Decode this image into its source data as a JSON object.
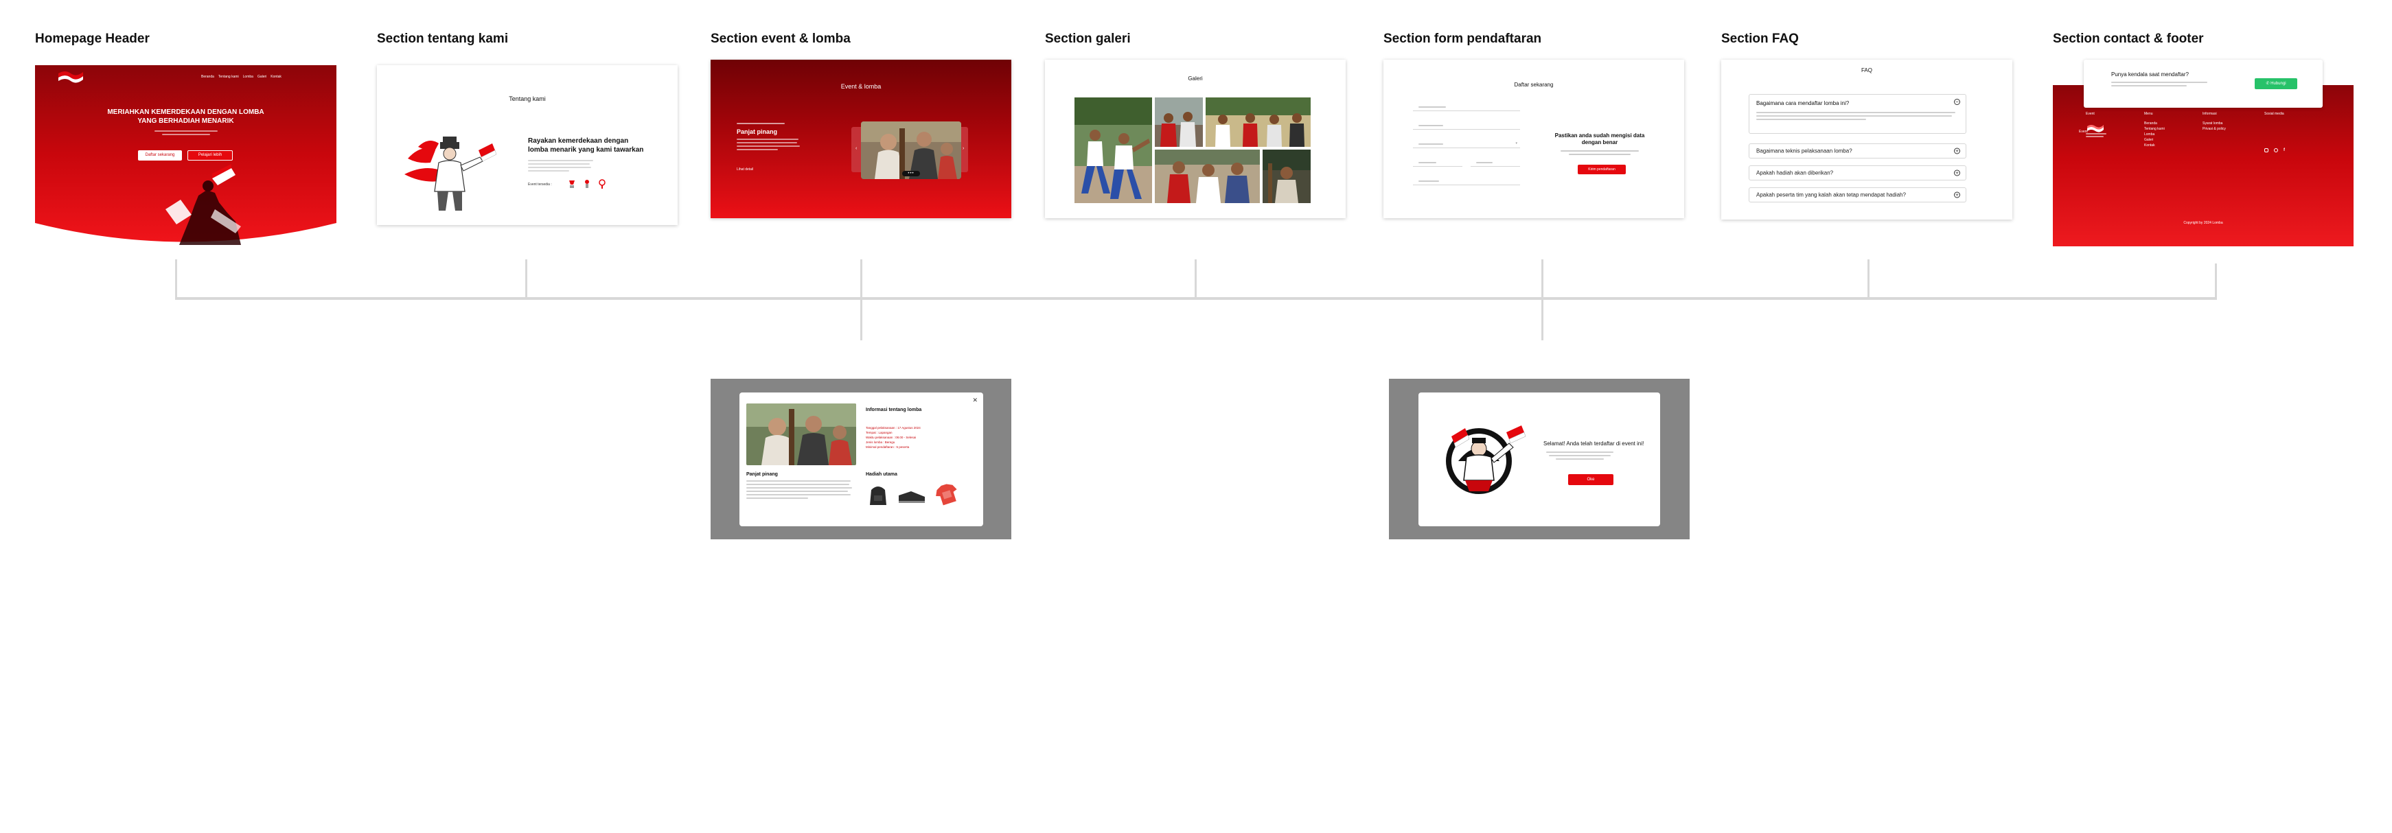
{
  "sections": {
    "header": "Homepage Header",
    "about": "Section tentang kami",
    "event": "Section event & lomba",
    "gallery": "Section galeri",
    "form": "Section form pendaftaran",
    "faq": "Section FAQ",
    "contact": "Section contact & footer"
  },
  "header_mock": {
    "nav": [
      "Beranda",
      "Tentang kami",
      "Lomba",
      "Galeri",
      "Kontak"
    ],
    "headline_1": "MERIAHKAN KEMERDEKAAN DENGAN LOMBA",
    "headline_2": "YANG BERHADIAH MENARIK",
    "btn_primary": "Daftar sekarang",
    "btn_secondary": "Pelajari lebih"
  },
  "about_mock": {
    "title": "Tentang kami",
    "heading": "Rayakan kemerdekaan dengan lomba menarik yang kami tawarkan",
    "event_label": "Event tersedia :"
  },
  "event_mock": {
    "title": "Event & lomba",
    "event_name": "Panjat pinang",
    "detail_link": "Lihat detail"
  },
  "gallery_mock": {
    "title": "Galeri"
  },
  "form_mock": {
    "title": "Daftar sekarang",
    "heading": "Pastikan anda sudah mengisi data dengan benar",
    "submit": "Kirim pendaftaran"
  },
  "faq_mock": {
    "title": "FAQ",
    "questions": [
      "Bagaimana cara mendaftar lomba ini?",
      "Bagaimana teknis pelaksanaan lomba?",
      "Apakah hadiah akan diberikan?",
      "Apakah peserta tim yang kalah akan tetap mendapat hadiah?"
    ]
  },
  "contact_mock": {
    "cta_title": "Punya kendala saat mendaftar?",
    "cta_button": "Hubungi",
    "cols": [
      "Event",
      "Menu",
      "Informasi",
      "Sosial media"
    ],
    "menu_items": [
      "Beranda",
      "Tentang kami",
      "Lomba",
      "Galeri",
      "Kontak"
    ],
    "info_items": [
      "Syarat lomba",
      "Privasi & policy"
    ],
    "copyright": "Copyright by 2024 Lomba"
  },
  "modal_mock": {
    "title": "Informasi tentang lomba",
    "close": "✕",
    "rules_title": "Hadiah utama",
    "desc_title": "Panjat pinang",
    "details": [
      "Tanggal pelaksanaan : 17 Agustus 2024",
      "Tempat : Lapangan",
      "Waktu pelaksanaan : 08.00 - Selesai",
      "Jenis lomba : Beregu",
      "Minimal pendaftaran : 5 peserta"
    ]
  },
  "success_mock": {
    "message": "Selamat! Anda telah terdaftar di event ini!",
    "button": "Oke"
  },
  "colors": {
    "brand_red": "#e5080e",
    "dark_red": "#8c0509",
    "overlay_gray": "#858585",
    "connector": "#d8d8d8",
    "cta_green": "#27c269"
  }
}
